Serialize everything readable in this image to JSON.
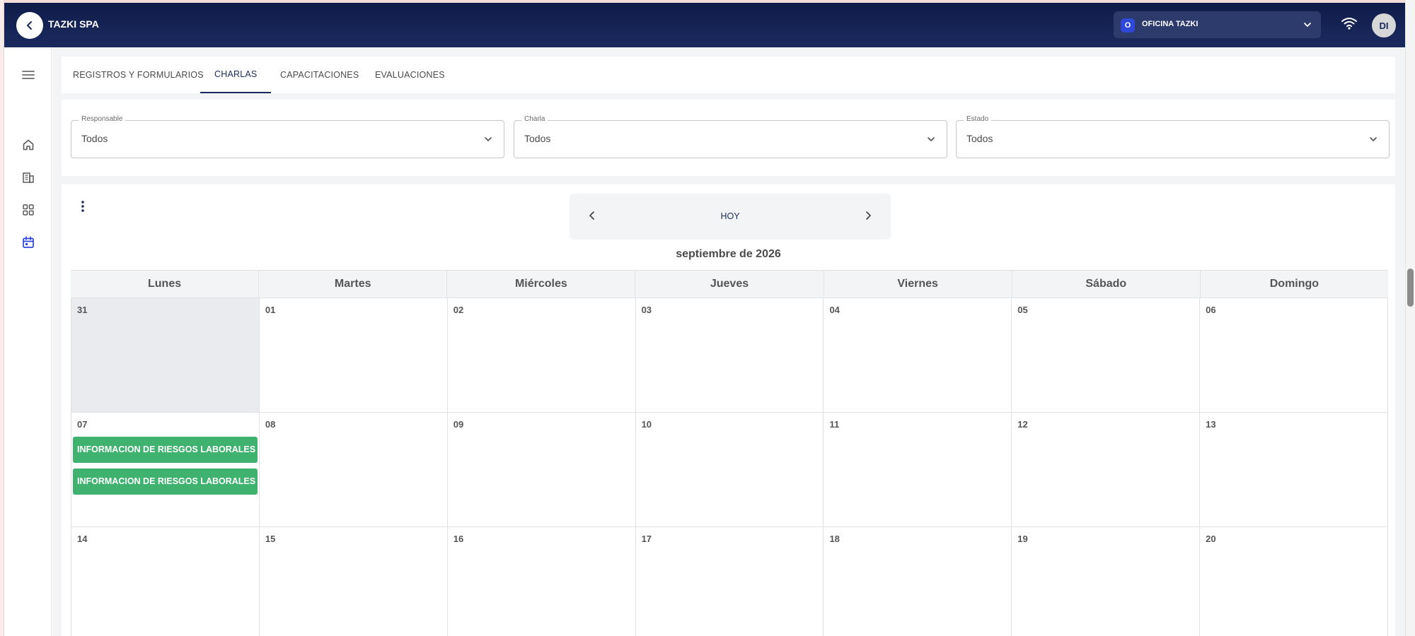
{
  "header": {
    "company": "TAZKI SPA",
    "office_badge": "O",
    "office_label": "OFICINA TAZKI",
    "avatar_initials": "DI"
  },
  "sidebar": {
    "items": [
      {
        "icon": "menu-icon"
      },
      {
        "icon": "home-icon"
      },
      {
        "icon": "building-icon"
      },
      {
        "icon": "grid-icon"
      },
      {
        "icon": "calendar-icon",
        "active": true
      }
    ]
  },
  "tabs": [
    {
      "label": "REGISTROS Y FORMULARIOS",
      "active": false
    },
    {
      "label": "CHARLAS",
      "active": true
    },
    {
      "label": "CAPACITACIONES",
      "active": false
    },
    {
      "label": "EVALUACIONES",
      "active": false
    }
  ],
  "filters": [
    {
      "label": "Responsable",
      "value": "Todos"
    },
    {
      "label": "Charla",
      "value": "Todos"
    },
    {
      "label": "Estado",
      "value": "Todos"
    }
  ],
  "calendar": {
    "today_label": "HOY",
    "month_title": "septiembre de 2026",
    "weekdays": [
      "Lunes",
      "Martes",
      "Miércoles",
      "Jueves",
      "Viernes",
      "Sábado",
      "Domingo"
    ],
    "weeks": [
      [
        "31",
        "01",
        "02",
        "03",
        "04",
        "05",
        "06"
      ],
      [
        "07",
        "08",
        "09",
        "10",
        "11",
        "12",
        "13"
      ],
      [
        "14",
        "15",
        "16",
        "17",
        "18",
        "19",
        "20"
      ]
    ],
    "events": [
      {
        "title": "INFORMACION DE RIESGOS LABORALES"
      },
      {
        "title": "INFORMACION DE RIESGOS LABORALES"
      }
    ]
  },
  "colors": {
    "header_bg": "#1b2a5e",
    "accent": "#1b2a5e",
    "event_green": "#3fb26f",
    "office_badge": "#2f48d8"
  }
}
